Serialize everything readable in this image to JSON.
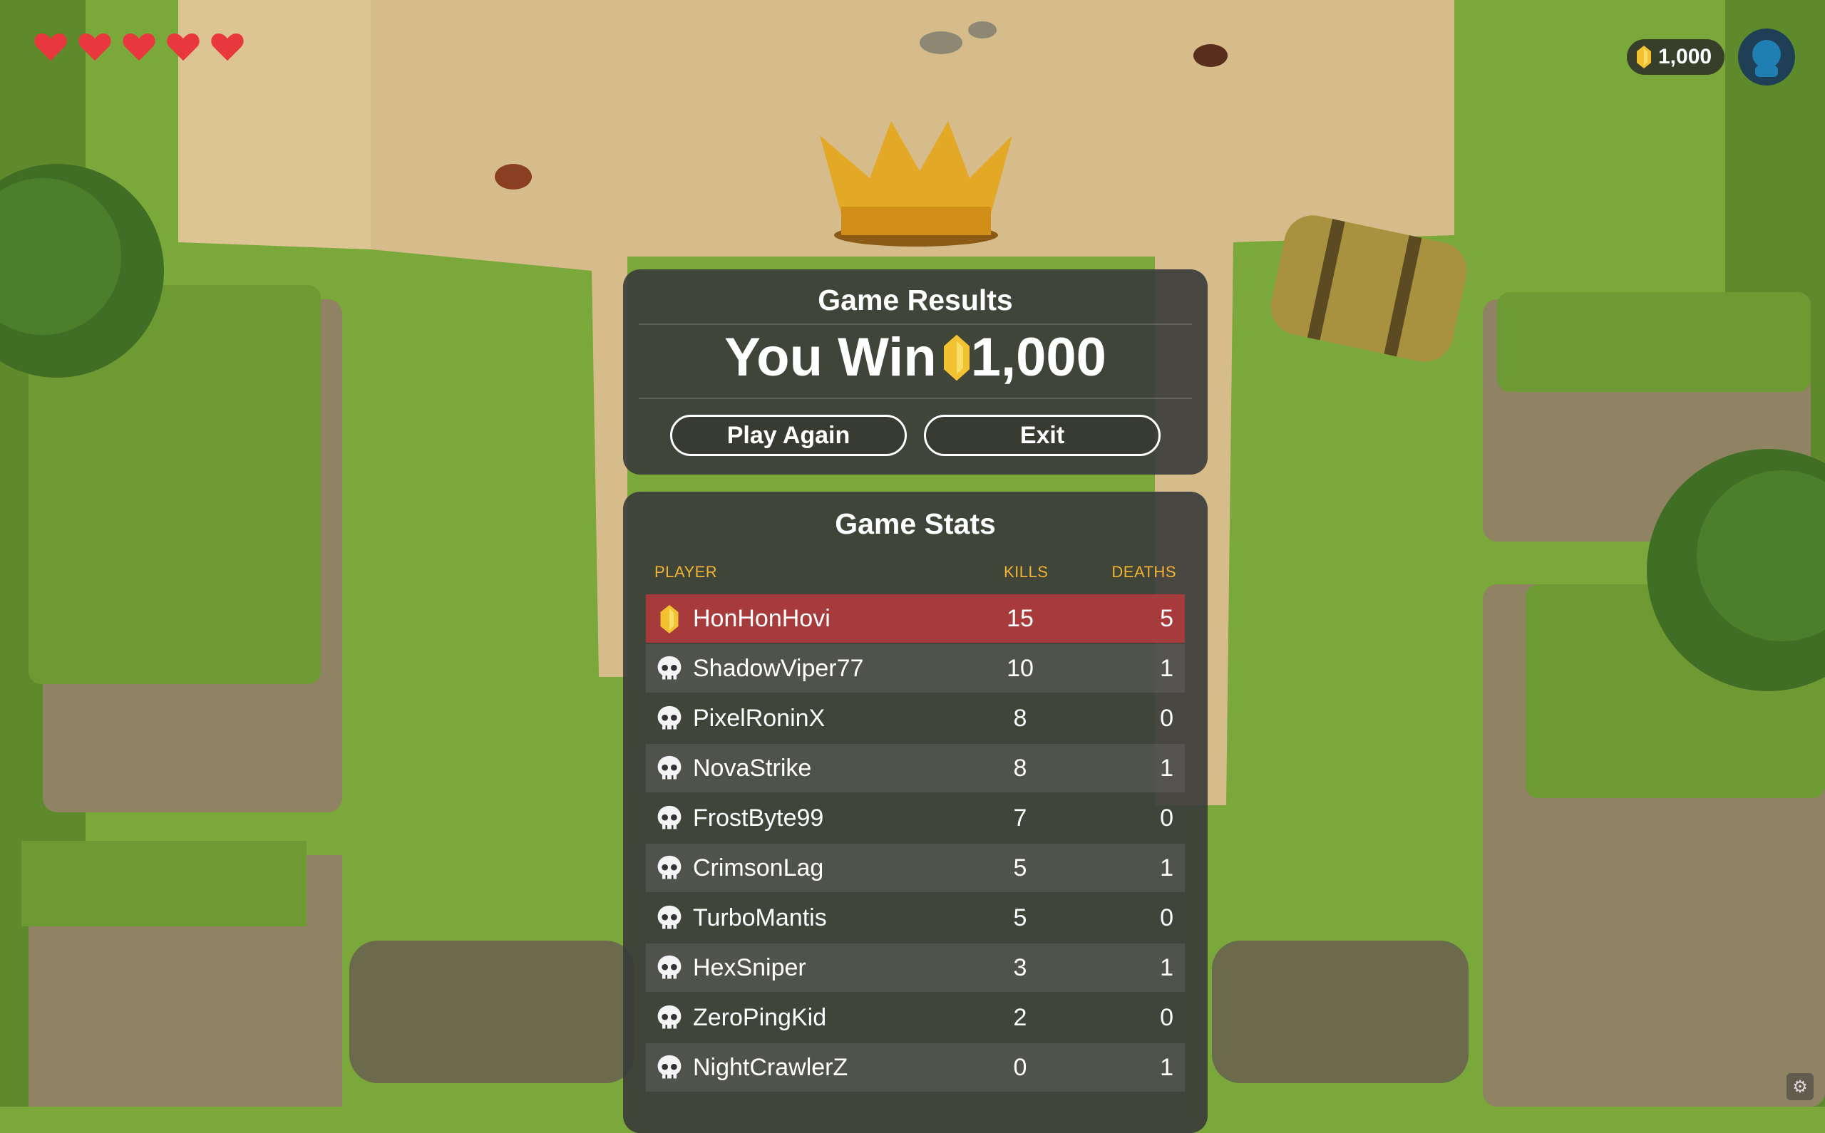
{
  "hud": {
    "hearts": 5,
    "coins": "1,000"
  },
  "results": {
    "title": "Game Results",
    "win_prefix": "You Win",
    "win_amount": "1,000",
    "play_again": "Play Again",
    "exit": "Exit"
  },
  "stats": {
    "title": "Game Stats",
    "col_player": "PLAYER",
    "col_kills": "KILLS",
    "col_deaths": "DEATHS",
    "rows": [
      {
        "player": "HonHonHovi",
        "kills": "15",
        "deaths": "5",
        "icon": "coin-icon",
        "highlight": true
      },
      {
        "player": "ShadowViper77",
        "kills": "10",
        "deaths": "1",
        "icon": "skull-icon"
      },
      {
        "player": "PixelRoninX",
        "kills": "8",
        "deaths": "0",
        "icon": "skull-icon"
      },
      {
        "player": "NovaStrike",
        "kills": "8",
        "deaths": "1",
        "icon": "skull-icon"
      },
      {
        "player": "FrostByte99",
        "kills": "7",
        "deaths": "0",
        "icon": "skull-icon"
      },
      {
        "player": "CrimsonLag",
        "kills": "5",
        "deaths": "1",
        "icon": "skull-icon"
      },
      {
        "player": "TurboMantis",
        "kills": "5",
        "deaths": "0",
        "icon": "skull-icon"
      },
      {
        "player": "HexSniper",
        "kills": "3",
        "deaths": "1",
        "icon": "skull-icon"
      },
      {
        "player": "ZeroPingKid",
        "kills": "2",
        "deaths": "0",
        "icon": "skull-icon"
      },
      {
        "player": "NightCrawlerZ",
        "kills": "0",
        "deaths": "1",
        "icon": "skull-icon"
      }
    ]
  },
  "colors": {
    "grass": "#7aa83a",
    "path": "#d6bc8a",
    "panel": "#3a3a3a",
    "highlight_row": "#a73a3a",
    "header_text": "#f2b233",
    "heart": "#e8383d",
    "coin": "#f2c230"
  }
}
